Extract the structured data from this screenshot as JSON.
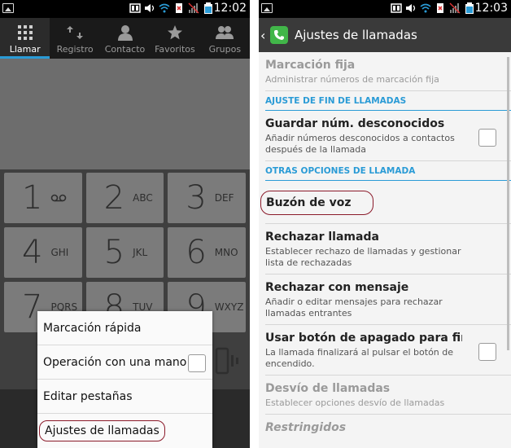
{
  "left": {
    "status": {
      "time": "12:02"
    },
    "tabs": [
      {
        "label": "Llamar",
        "icon": "keypad-icon",
        "active": true
      },
      {
        "label": "Registro",
        "icon": "call-log-icon",
        "active": false
      },
      {
        "label": "Contacto",
        "icon": "contact-icon",
        "active": false
      },
      {
        "label": "Favoritos",
        "icon": "star-icon",
        "active": false
      },
      {
        "label": "Grupos",
        "icon": "group-icon",
        "active": false
      }
    ],
    "keys": [
      [
        {
          "num": "1",
          "letters": ""
        },
        {
          "num": "2",
          "letters": "ABC"
        },
        {
          "num": "3",
          "letters": "DEF"
        }
      ],
      [
        {
          "num": "4",
          "letters": "GHI"
        },
        {
          "num": "5",
          "letters": "JKL"
        },
        {
          "num": "6",
          "letters": "MNO"
        }
      ],
      [
        {
          "num": "7",
          "letters": "PQRS"
        },
        {
          "num": "8",
          "letters": "TUV"
        },
        {
          "num": "9",
          "letters": "WXYZ"
        }
      ]
    ],
    "menu": [
      {
        "label": "Marcación rápida"
      },
      {
        "label": "Operación con una mano"
      },
      {
        "label": "Editar pestañas"
      },
      {
        "label": "Ajustes de llamadas"
      }
    ]
  },
  "right": {
    "status": {
      "time": "12:03"
    },
    "header": {
      "title": "Ajustes de llamadas"
    },
    "items": {
      "fixed": {
        "title": "Marcación fija",
        "subtitle": "Administrar números de marcación fija"
      },
      "section_end": "AJUSTE DE FIN DE LLAMADAS",
      "save_unknown": {
        "title": "Guardar núm. desconocidos",
        "subtitle": "Añadir números desconocidos a contactos después de la llamada"
      },
      "section_other": "OTRAS OPCIONES DE LLAMADA",
      "voicemail": {
        "title": "Buzón de voz"
      },
      "reject": {
        "title": "Rechazar llamada",
        "subtitle": "Establecer rechazo de llamadas y gestionar lista de rechazadas"
      },
      "reject_msg": {
        "title": "Rechazar con mensaje",
        "subtitle": "Añadir o editar mensajes para rechazar llamadas entrantes"
      },
      "power_end": {
        "title": "Usar botón de apagado para finaliz",
        "subtitle": "La llamada finalizará al pulsar el botón de encendido."
      },
      "forward": {
        "title": "Desvío de llamadas",
        "subtitle": "Establecer opciones desvío de llamadas"
      },
      "restricted": {
        "title": "Restringidos"
      }
    }
  },
  "colors": {
    "accent": "#2a9bd6",
    "annotation": "#8b1a2a",
    "phone_green": "#41b649"
  }
}
